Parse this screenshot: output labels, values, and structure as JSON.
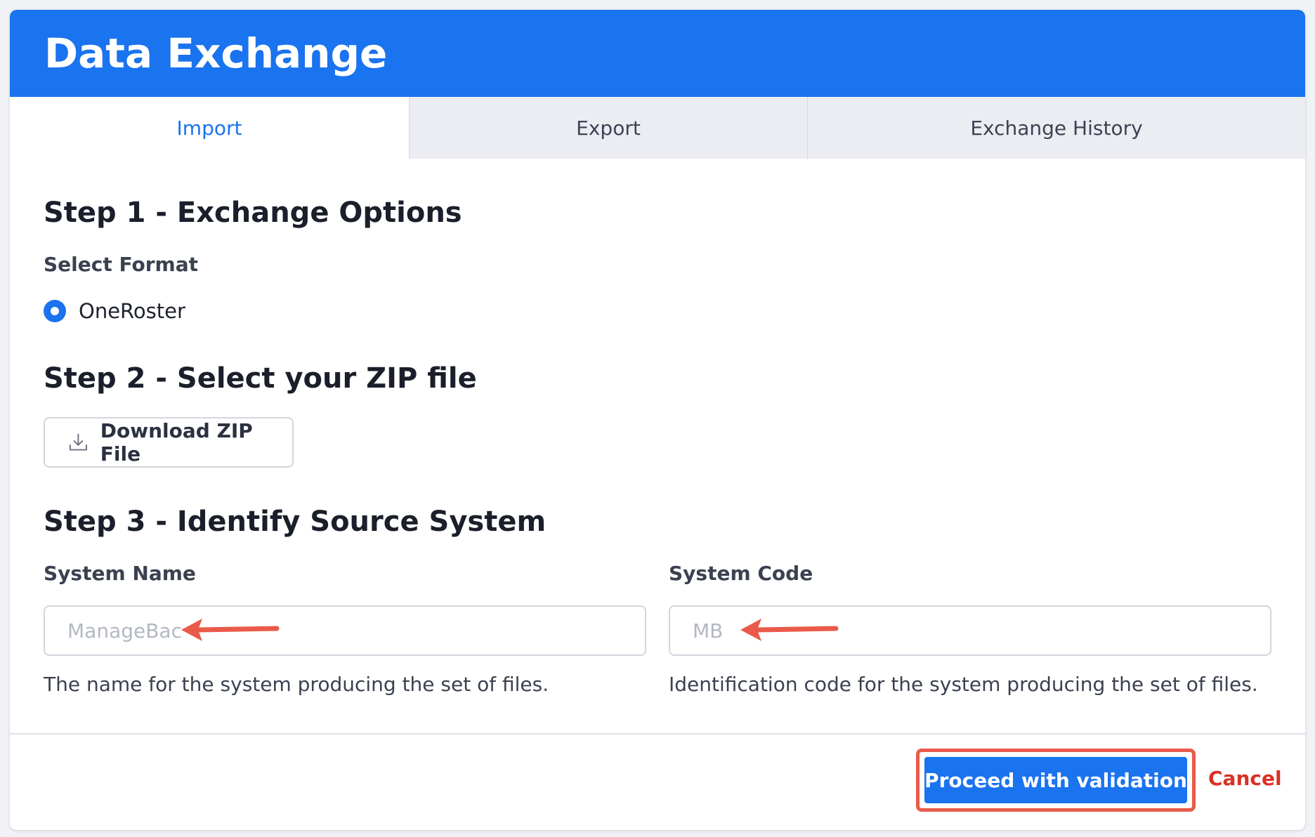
{
  "header": {
    "title": "Data Exchange"
  },
  "tabs": [
    {
      "label": "Import",
      "active": true
    },
    {
      "label": "Export",
      "active": false
    },
    {
      "label": "Exchange History",
      "active": false
    }
  ],
  "step1": {
    "title": "Step 1 - Exchange Options",
    "format_label": "Select Format",
    "format_option": "OneRoster",
    "selected": true
  },
  "step2": {
    "title": "Step 2 - Select your ZIP file",
    "button_label": "Download ZIP File",
    "button_icon": "download-icon"
  },
  "step3": {
    "title": "Step 3 - Identify Source System",
    "system_name": {
      "label": "System Name",
      "placeholder": "ManageBac",
      "value": "",
      "help": "The name for the system producing the set of files."
    },
    "system_code": {
      "label": "System Code",
      "placeholder": "MB",
      "value": "",
      "help": "Identification code for the system producing the set of files."
    }
  },
  "footer": {
    "proceed_label": "Proceed with validation",
    "cancel_label": "Cancel"
  },
  "colors": {
    "primary": "#1a73ef",
    "danger": "#d93025",
    "annotation": "#ea5a4a"
  }
}
